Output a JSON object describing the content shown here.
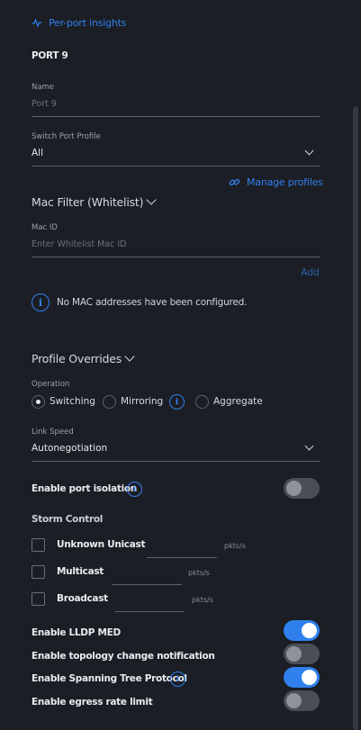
{
  "header": {
    "insights_link": "Per-port insights"
  },
  "port": {
    "title": "PORT 9"
  },
  "name_field": {
    "label": "Name",
    "placeholder": "Port 9"
  },
  "profile_field": {
    "label": "Switch Port Profile",
    "value": "All",
    "manage_link": "Manage profiles"
  },
  "mac_filter": {
    "title": "Mac Filter (Whitelist)",
    "label": "Mac ID",
    "placeholder": "Enter Whitelist Mac ID",
    "add_label": "Add",
    "empty_message": "No MAC addresses have been configured."
  },
  "overrides": {
    "title": "Profile Overrides",
    "operation_label": "Operation",
    "operations": [
      "Switching",
      "Mirroring",
      "Aggregate"
    ],
    "selected_operation": "Switching"
  },
  "link_speed": {
    "label": "Link Speed",
    "value": "Autonegotiation"
  },
  "port_isolation": {
    "label": "Enable port isolation",
    "enabled": false
  },
  "storm_control": {
    "title": "Storm Control",
    "items": [
      {
        "label": "Unknown Unicast",
        "unit": "pkts/s",
        "checked": false
      },
      {
        "label": "Multicast",
        "unit": "pkts/s",
        "checked": false
      },
      {
        "label": "Broadcast",
        "unit": "pkts/s",
        "checked": false
      }
    ]
  },
  "toggles": [
    {
      "label": "Enable LLDP MED",
      "enabled": true
    },
    {
      "label": "Enable topology change notification",
      "enabled": false
    },
    {
      "label": "Enable Spanning Tree Protocol",
      "enabled": true
    },
    {
      "label": "Enable egress rate limit",
      "enabled": false
    }
  ],
  "colors": {
    "accent": "#2f80ed",
    "background": "#1c1e25"
  }
}
